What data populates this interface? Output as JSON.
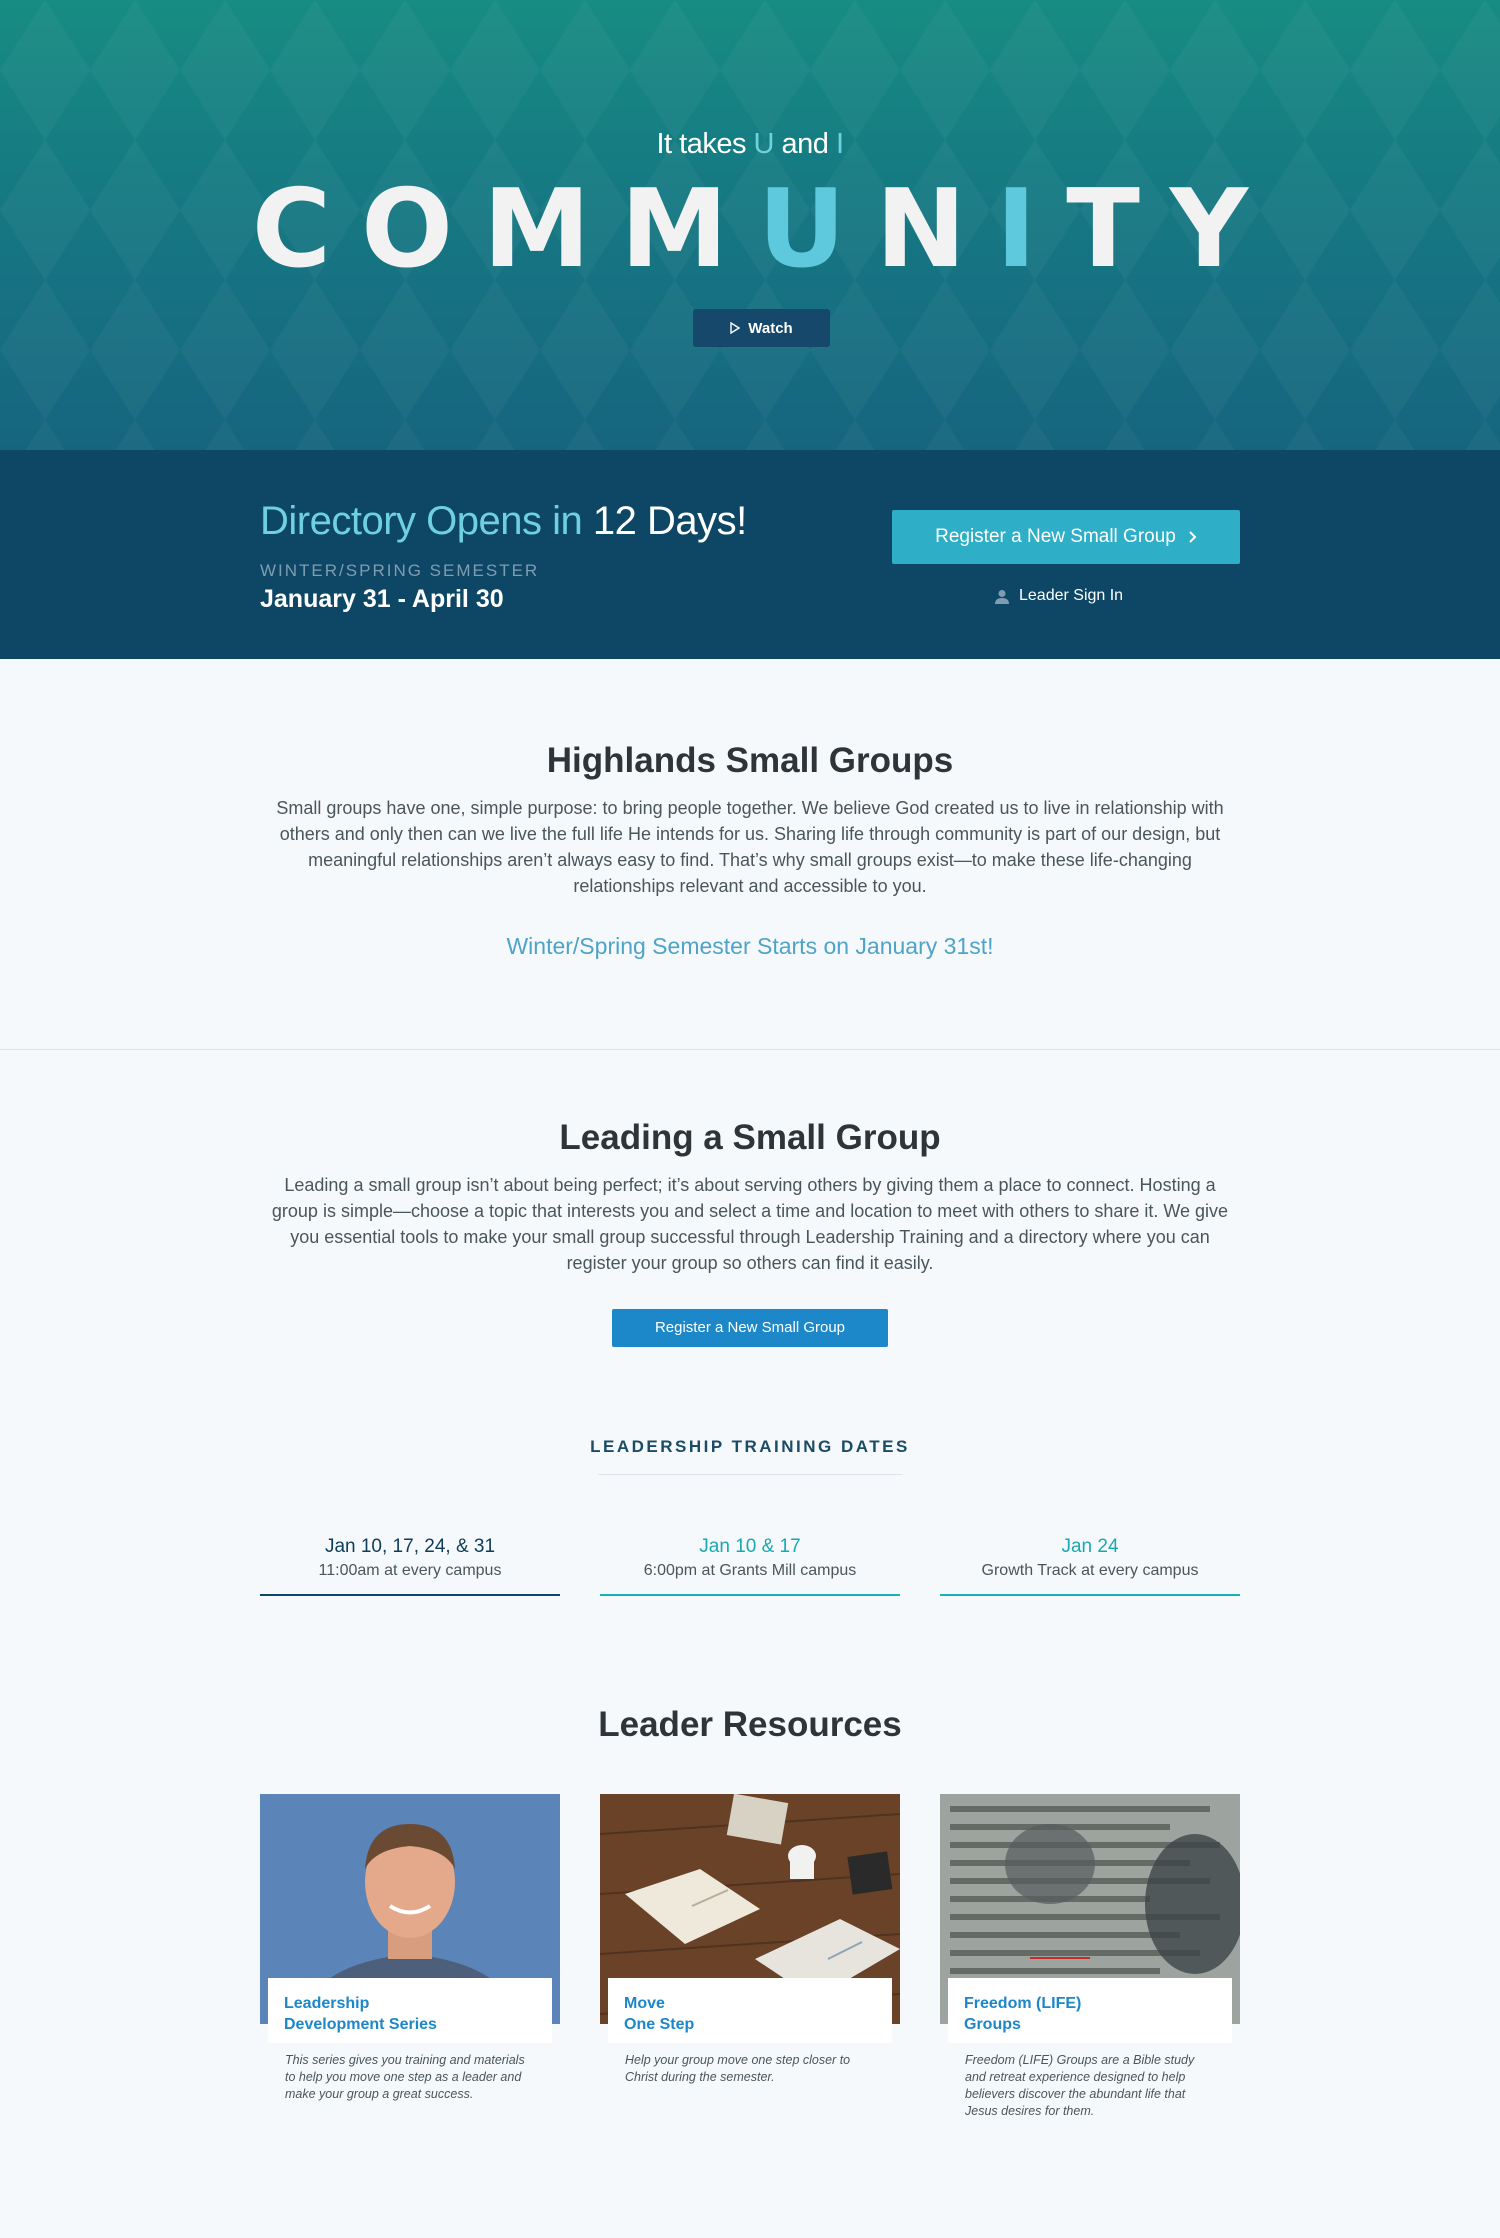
{
  "hero": {
    "tagline_pre": "It takes ",
    "tagline_u": "U",
    "tagline_mid": " and ",
    "tagline_i": "I",
    "word": {
      "a": "COMM",
      "b": "U",
      "c": "N",
      "d": "I",
      "e": "TY"
    },
    "watch_label": "Watch",
    "watch_icon": "play-icon"
  },
  "directory": {
    "countdown_prefix": "Directory Opens in ",
    "countdown_value": "12 Days!",
    "semester": "WINTER/SPRING SEMESTER",
    "dates": "January 31 - April 30",
    "register_label": "Register a New Small Group",
    "register_icon": "chevron-right-icon",
    "signin_label": "Leader Sign In",
    "signin_icon": "user-icon"
  },
  "intro": {
    "title": "Highlands Small Groups",
    "text": "Small groups have one, simple purpose: to bring people together. We believe God created us to live in relationship with others and only then can we live the full life He intends for us. Sharing life through community is part of our design, but meaningful relationships aren’t always easy to find. That’s why small groups exist—to make these life-changing relationships relevant and accessible to you.",
    "starts": "Winter/Spring Semester Starts on January 31st!"
  },
  "leading": {
    "title": "Leading a Small Group",
    "text": "Leading a small group isn’t about being perfect; it’s about serving others by giving them a place to connect. Hosting a group is simple—choose a topic that interests you and select a time and location to meet with others to share it. We give you essential tools to make your small group successful through Leadership Training and a directory where you can register your group so others can find it easily.",
    "button": "Register a New Small Group"
  },
  "training": {
    "title": "LEADERSHIP TRAINING DATES",
    "dates": [
      {
        "date": "Jan 10, 17, 24, & 31",
        "detail": "11:00am at every campus"
      },
      {
        "date": "Jan 10 & 17",
        "detail": "6:00pm at Grants Mill campus"
      },
      {
        "date": "Jan 24",
        "detail": "Growth Track at every campus"
      }
    ]
  },
  "resources": {
    "title": "Leader Resources",
    "cards": [
      {
        "line1": "Leadership",
        "line2": "Development Series",
        "desc": "This series gives you training and materials to help you move one step as a leader and make your group a great success."
      },
      {
        "line1": "Move",
        "line2": "One Step",
        "desc": "Help your group move one step closer to Christ during the semester."
      },
      {
        "line1": "Freedom (LIFE)",
        "line2": "Groups",
        "desc": "Freedom (LIFE) Groups are a Bible study and retreat experience designed to help believers discover the abundant life that Jesus desires for them."
      }
    ]
  },
  "colors": {
    "hero_top": "#178c82",
    "hero_bottom": "#16657f",
    "band": "#0e4766",
    "accent": "#2eaec7",
    "button_blue": "#1c87c9",
    "highlight": "#6fd0e0"
  }
}
